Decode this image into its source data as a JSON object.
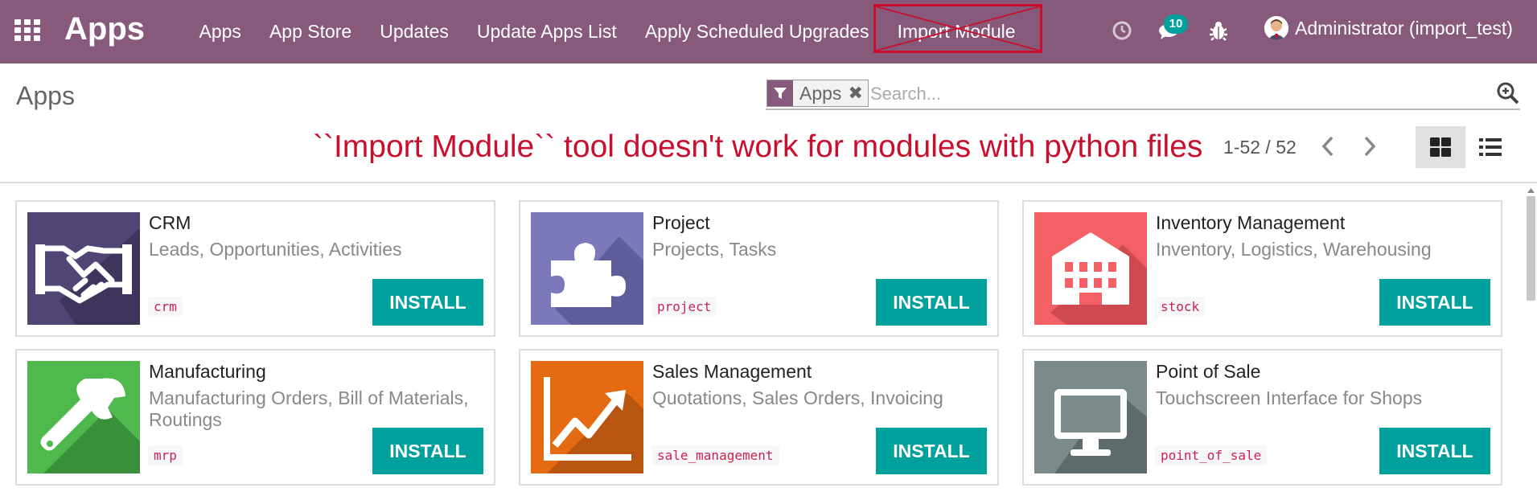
{
  "navbar": {
    "brand": "Apps",
    "menu": [
      "Apps",
      "App Store",
      "Updates",
      "Update Apps List",
      "Apply Scheduled Upgrades",
      "Import Module"
    ],
    "crossed_item_index": 5,
    "messages_count": "10",
    "user": "Administrator (import_test)",
    "icons": [
      "apps-grid-icon",
      "clock-icon",
      "chat-icon",
      "bug-icon"
    ]
  },
  "control_panel": {
    "title": "Apps",
    "facet_label": "Apps",
    "search_placeholder": "Search...",
    "pager": "1-52 / 52",
    "annotation": "``Import Module`` tool doesn't work for modules with python files"
  },
  "apps": [
    {
      "name": "CRM",
      "summary": "Leads, Opportunities, Activities",
      "technical": "crm",
      "button": "INSTALL",
      "color": "#514575",
      "icon": "handshake-icon"
    },
    {
      "name": "Project",
      "summary": "Projects, Tasks",
      "technical": "project",
      "button": "INSTALL",
      "color": "#7b79b9",
      "icon": "puzzle-icon"
    },
    {
      "name": "Inventory Management",
      "summary": "Inventory, Logistics, Warehousing",
      "technical": "stock",
      "button": "INSTALL",
      "color": "#f36065",
      "icon": "warehouse-icon"
    },
    {
      "name": "Manufacturing",
      "summary": "Manufacturing Orders, Bill of Materials, Routings",
      "technical": "mrp",
      "button": "INSTALL",
      "color": "#4fb94e",
      "icon": "wrench-icon"
    },
    {
      "name": "Sales Management",
      "summary": "Quotations, Sales Orders, Invoicing",
      "technical": "sale_management",
      "button": "INSTALL",
      "color": "#e46b12",
      "icon": "chart-icon"
    },
    {
      "name": "Point of Sale",
      "summary": "Touchscreen Interface for Shops",
      "technical": "point_of_sale",
      "button": "INSTALL",
      "color": "#7b8b8c",
      "icon": "monitor-icon"
    }
  ],
  "colors": {
    "navbar": "#875a7b",
    "install": "#00a09d",
    "annotation": "#c8102e"
  }
}
